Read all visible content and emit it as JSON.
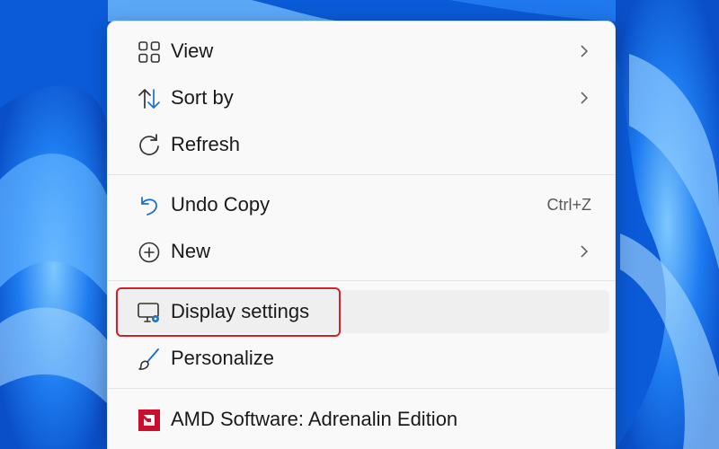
{
  "context_menu": {
    "items": [
      {
        "label": "View",
        "icon": "grid-icon",
        "submenu": true
      },
      {
        "label": "Sort by",
        "icon": "sort-arrows-icon",
        "submenu": true
      },
      {
        "label": "Refresh",
        "icon": "refresh-icon",
        "submenu": false
      },
      {
        "label": "Undo Copy",
        "icon": "undo-icon",
        "shortcut": "Ctrl+Z"
      },
      {
        "label": "New",
        "icon": "plus-circle-icon",
        "submenu": true
      },
      {
        "label": "Display settings",
        "icon": "display-settings-icon",
        "highlighted": true
      },
      {
        "label": "Personalize",
        "icon": "brush-icon"
      },
      {
        "label": "AMD Software: Adrenalin Edition",
        "icon": "amd-logo-icon"
      }
    ]
  },
  "colors": {
    "wallpaper": "#0a5fe0",
    "menu_bg": "#f9f9f9",
    "highlight_border": "#d51f2a",
    "icon_accent": "#1a73c8"
  }
}
